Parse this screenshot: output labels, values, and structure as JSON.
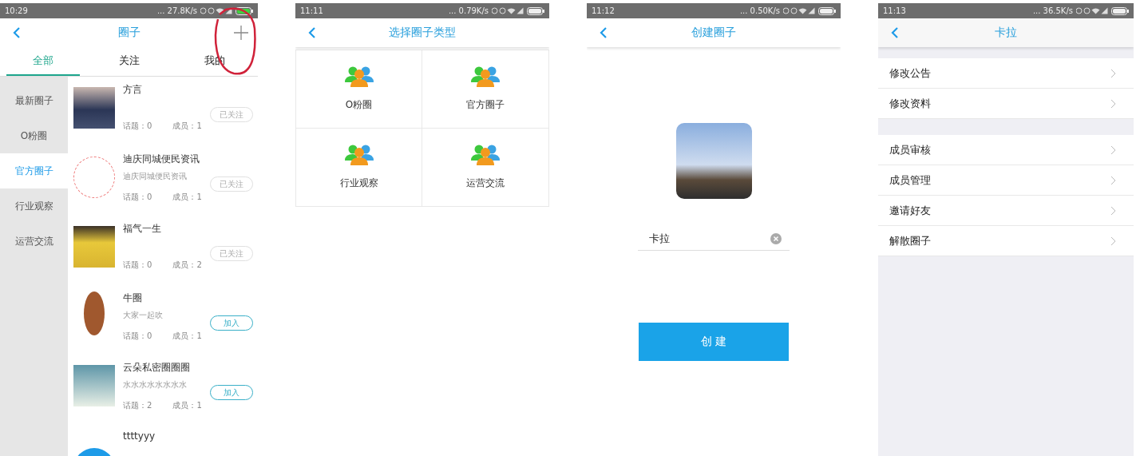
{
  "screens": [
    {
      "kind": "circle_list",
      "status": {
        "time": "10:29",
        "speed": "... 27.8K/s",
        "charging": true
      },
      "title": "圈子",
      "tabs": [
        {
          "label": "全部",
          "selected": true
        },
        {
          "label": "关注",
          "selected": false
        },
        {
          "label": "我的",
          "selected": false
        }
      ],
      "categories": [
        {
          "label": "最新圈子",
          "selected": false
        },
        {
          "label": "O粉圈",
          "selected": false
        },
        {
          "label": "官方圈子",
          "selected": true
        },
        {
          "label": "行业观察",
          "selected": false
        },
        {
          "label": "运营交流",
          "selected": false
        }
      ],
      "circles": [
        {
          "name": "方言",
          "topics": "话题：0",
          "members": "成员：1",
          "button": {
            "label": "已关注",
            "followed": true
          }
        },
        {
          "name": "迪庆同城便民资讯",
          "desc": "迪庆同城便民资讯",
          "topics": "话题：0",
          "members": "成员：1",
          "button": {
            "label": "已关注",
            "followed": true
          }
        },
        {
          "name": "福气一生",
          "topics": "话题：0",
          "members": "成员：2",
          "button": {
            "label": "已关注",
            "followed": true
          }
        },
        {
          "name": "牛圈",
          "desc": "大家一起吹",
          "topics": "话题：0",
          "members": "成员：1",
          "button": {
            "label": "加入",
            "followed": false
          }
        },
        {
          "name": "云朵私密圈圈圈",
          "desc": "水水水水水水水水",
          "topics": "话题：2",
          "members": "成员：1",
          "button": {
            "label": "加入",
            "followed": false
          }
        },
        {
          "name": "ttttyyy"
        }
      ]
    },
    {
      "kind": "type_grid",
      "status": {
        "time": "11:11",
        "speed": "... 0.79K/s",
        "charging": false
      },
      "title": "选择圈子类型",
      "types": [
        {
          "label": "O粉圈"
        },
        {
          "label": "官方圈子"
        },
        {
          "label": "行业观察"
        },
        {
          "label": "运营交流"
        }
      ]
    },
    {
      "kind": "create_form",
      "status": {
        "time": "11:12",
        "speed": "... 0.50K/s",
        "charging": false
      },
      "title": "创建圈子",
      "name_field": {
        "value": "卡拉"
      },
      "submit": "创 建"
    },
    {
      "kind": "settings",
      "status": {
        "time": "11:13",
        "speed": "... 36.5K/s",
        "charging": false
      },
      "title": "卡拉",
      "groups": [
        [
          {
            "label": "修改公告"
          },
          {
            "label": "修改资料"
          }
        ],
        [
          {
            "label": "成员审核"
          },
          {
            "label": "成员管理"
          },
          {
            "label": "邀请好友"
          },
          {
            "label": "解散圈子"
          }
        ]
      ]
    }
  ]
}
